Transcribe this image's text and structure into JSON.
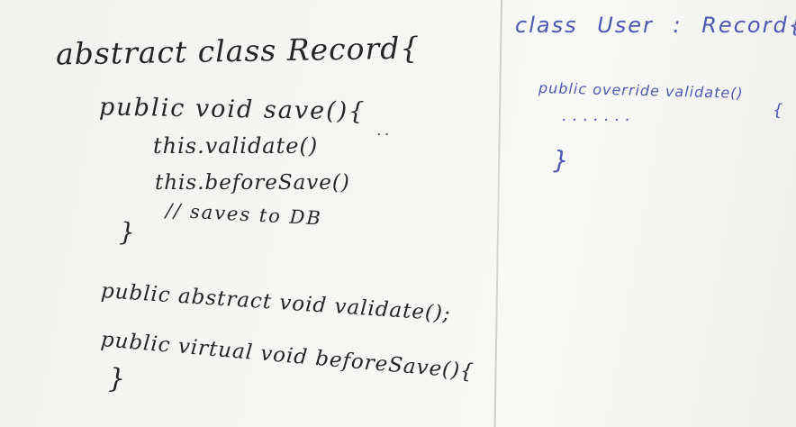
{
  "left_panel": {
    "lines": [
      "abstract class Record{",
      "public void save(){",
      "this.validate()",
      "this.beforeSave()",
      "// saves to DB",
      "}",
      "public abstract void validate();",
      "public virtual void beforeSave(){",
      "}"
    ],
    "dots": ".."
  },
  "right_panel": {
    "lines": [
      "class User : Record{",
      "public override validate()",
      "{",
      ".......",
      "}"
    ]
  },
  "colors": {
    "board": "#f4f4f2",
    "black_marker": "#262626",
    "blue_marker": "#4d58b0",
    "divider": "#c4c4c1"
  }
}
